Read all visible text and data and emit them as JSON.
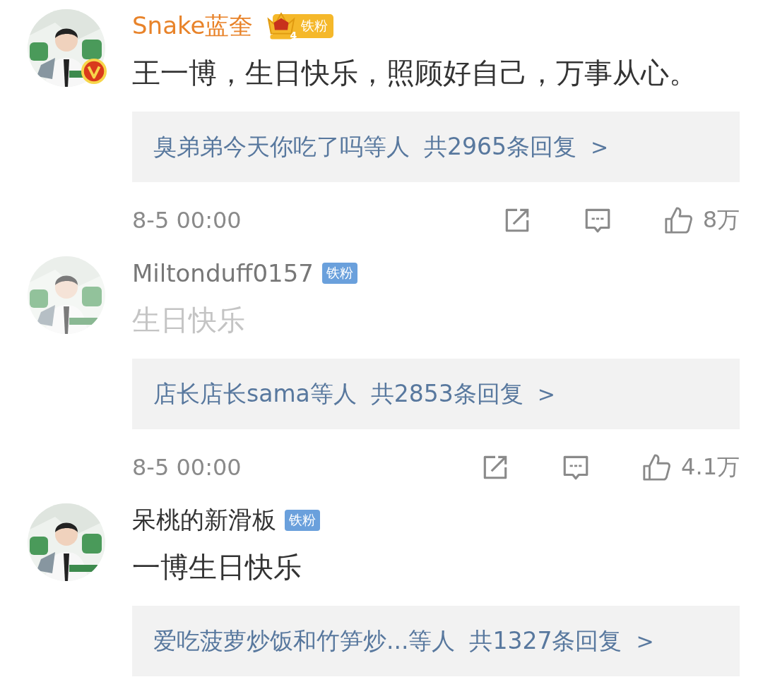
{
  "comments": [
    {
      "username": "Snake蓝奎",
      "vip": true,
      "verified": true,
      "dimmed": false,
      "fan_badge": {
        "kind": "crown",
        "level": "4",
        "label": "铁粉"
      },
      "text": "王一博，生日快乐，照顾好自己，万事从心。",
      "replies_summary": {
        "users": "臭弟弟今天你吃了吗等人",
        "count": "共2965条回复",
        "chevron": ">"
      },
      "meta": {
        "time": "8-5 00:00",
        "likes": "8万"
      }
    },
    {
      "username": "Miltonduff0157",
      "vip": false,
      "verified": false,
      "dimmed": true,
      "fan_badge": {
        "kind": "plain",
        "label": "铁粉"
      },
      "text": "生日快乐",
      "replies_summary": {
        "users": "店长店长sama等人",
        "count": "共2853条回复",
        "chevron": ">"
      },
      "meta": {
        "time": "8-5 00:00",
        "likes": "4.1万"
      }
    },
    {
      "username": "呆桃的新滑板",
      "vip": false,
      "verified": false,
      "dimmed": false,
      "fan_badge": {
        "kind": "plain",
        "label": "铁粉"
      },
      "text": "一博生日快乐",
      "replies_summary": {
        "users": "爱吃菠萝炒饭和竹笋炒...等人",
        "count": "共1327条回复",
        "chevron": ">"
      }
    }
  ]
}
